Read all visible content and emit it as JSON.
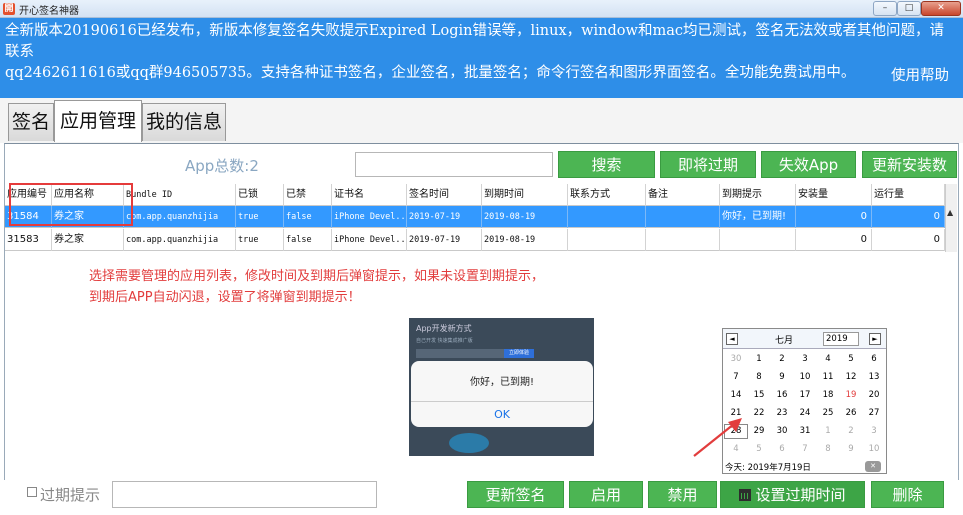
{
  "window": {
    "title": "开心签名神器",
    "app_icon": "開",
    "min": "–",
    "max": "□",
    "close": "✕"
  },
  "notice": {
    "line1": "全新版本20190616已经发布，新版本修复签名失败提示Expired Login错误等，linux，window和mac均已测试，签名无法效或者其他问题，请联系",
    "line2": "qq2462611616或qq群946505735。支持各种证书签名，企业签名，批量签名；命令行签名和图形界面签名。全功能免费试用中。",
    "help": "使用帮助"
  },
  "tabs": [
    "签名",
    "应用管理",
    "我的信息"
  ],
  "toolbar": {
    "count": "App总数:2",
    "search_value": "",
    "search": "搜索",
    "expiring": "即将过期",
    "invalid": "失效App",
    "update_count": "更新安装数"
  },
  "table": {
    "columns": [
      "应用编号",
      "应用名称",
      "Bundle ID",
      "已锁",
      "已禁",
      "证书名",
      "签名时间",
      "到期时间",
      "联系方式",
      "备注",
      "到期提示",
      "安装量",
      "运行量"
    ],
    "rows": [
      [
        "31584",
        "券之家",
        "com.app.quanzhijia",
        "true",
        "false",
        "iPhone Devel...",
        "2019-07-19",
        "2019-08-19",
        "",
        "",
        "你好，已到期!",
        "0",
        "0"
      ],
      [
        "31583",
        "券之家",
        "com.app.quanzhijia",
        "true",
        "false",
        "iPhone Devel...",
        "2019-07-19",
        "2019-08-19",
        "",
        "",
        "",
        "0",
        "0"
      ]
    ]
  },
  "instruction": {
    "line1": "选择需要管理的应用列表，修改时间及到期后弹窗提示，如果未设置到期提示，",
    "line2": "到期后APP自动闪退，设置了将弹窗到期提示！"
  },
  "preview": {
    "title": "App开发新方式",
    "subtitle": "自己开发 快速集成推广版",
    "button": "立即体验",
    "dialog_message": "你好，已到期!",
    "dialog_ok": "OK"
  },
  "calendar": {
    "month": "七月",
    "year": "2019",
    "prev": "◄",
    "next": "►",
    "weeks": [
      [
        "30",
        "1",
        "2",
        "3",
        "4",
        "5",
        "6"
      ],
      [
        "7",
        "8",
        "9",
        "10",
        "11",
        "12",
        "13"
      ],
      [
        "14",
        "15",
        "16",
        "17",
        "18",
        "19",
        "20"
      ],
      [
        "21",
        "22",
        "23",
        "24",
        "25",
        "26",
        "27"
      ],
      [
        "28",
        "29",
        "30",
        "31",
        "1",
        "2",
        "3"
      ],
      [
        "4",
        "5",
        "6",
        "7",
        "8",
        "9",
        "10"
      ]
    ],
    "today": "今天: 2019年7月19日",
    "clear": "✕",
    "highlight_color": "#e23d3d"
  },
  "bottom": {
    "expire_hint": "过期提示",
    "expire_value": "",
    "update_sign": "更新签名",
    "enable": "启用",
    "disable": "禁用",
    "set_expire": "设置过期时间",
    "delete": "删除"
  },
  "colors": {
    "notice_bg": "#2e8ee8",
    "button_green": "#4cb553",
    "selected_row": "#3399ff",
    "annotation_red": "#e23d3d"
  }
}
